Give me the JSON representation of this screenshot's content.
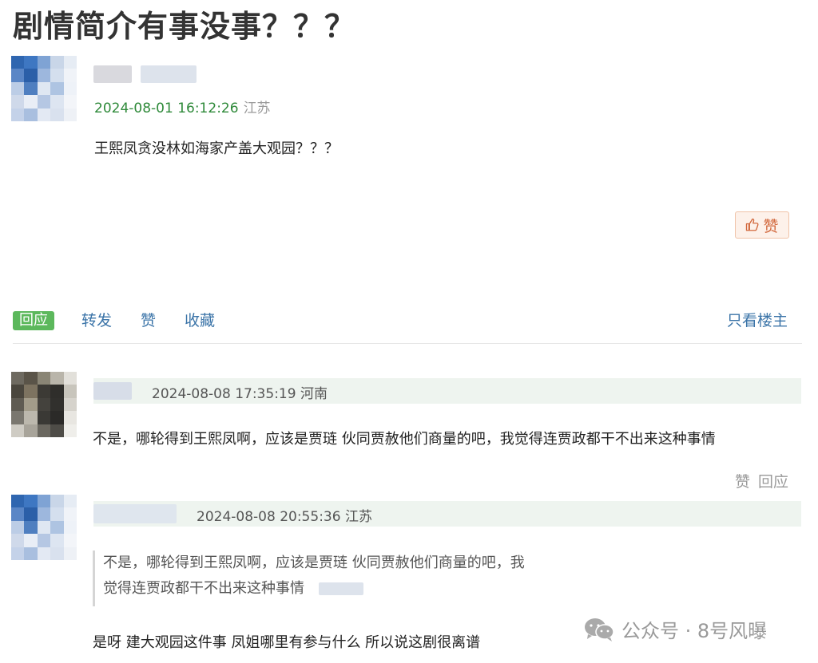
{
  "thread": {
    "title": "剧情简介有事没事？？？"
  },
  "post": {
    "time": "2024-08-01 16:12:26",
    "location": "江苏",
    "content": "王熙凤贪没林如海家产盖大观园？？？",
    "like_label": "赞",
    "like_icon": "thumbs-up-icon"
  },
  "action_bar": {
    "reply": "回应",
    "forward": "转发",
    "like": "赞",
    "collect": "收藏",
    "only_op": "只看楼主"
  },
  "replies": [
    {
      "time": "2024-08-08 17:35:19",
      "location": "河南",
      "content": "不是，哪轮得到王熙凤啊，应该是贾琏 伙同贾赦他们商量的吧，我觉得连贾政都干不出来这种事情",
      "like": "赞",
      "reply": "回应"
    },
    {
      "time": "2024-08-08 20:55:36",
      "location": "江苏",
      "quote_line1": "不是，哪轮得到王熙凤啊，应该是贾琏 伙同贾赦他们商量的吧，我",
      "quote_line2": "觉得连贾政都干不出来这种事情",
      "content": "是呀 建大观园这件事 凤姐哪里有参与什么 所以说这剧很离谱"
    }
  ],
  "watermark": {
    "text": "公众号 · 8号风曝",
    "icon": "wechat-icon"
  },
  "colors": {
    "accent_green": "#5cb85c",
    "link_blue": "#3b74a8",
    "like_orange": "#d2693e",
    "time_green": "#2f8a3a"
  }
}
